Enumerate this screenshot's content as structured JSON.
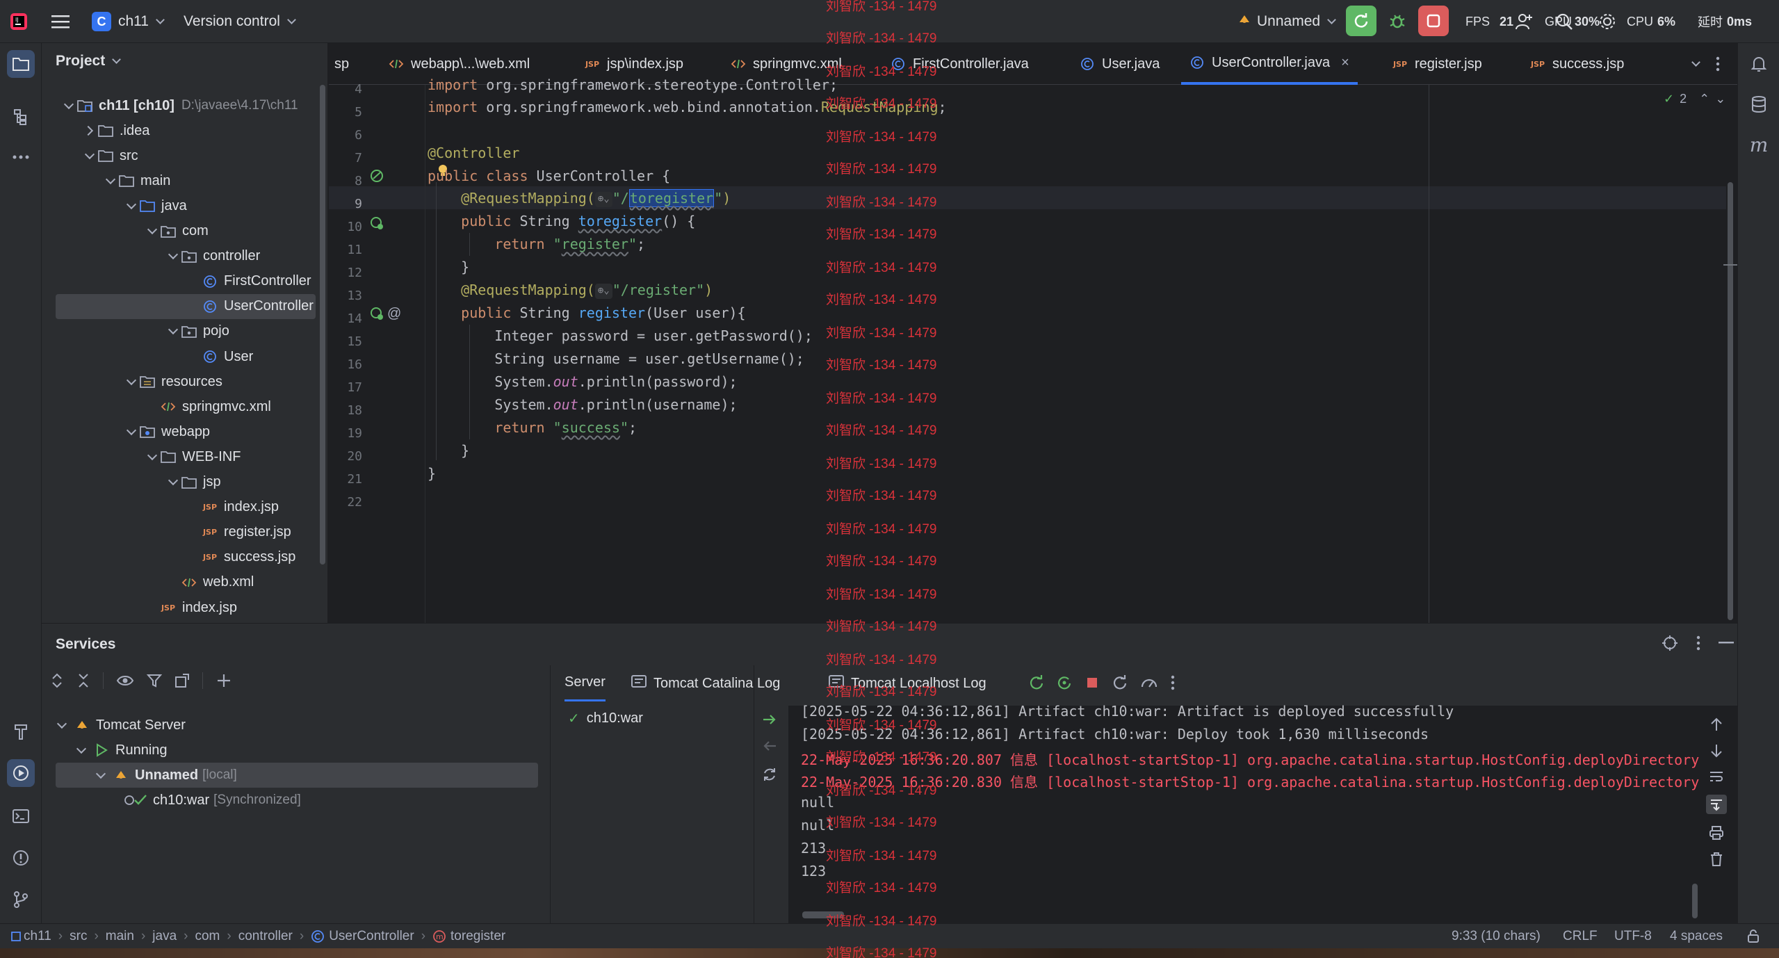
{
  "titlebar": {
    "project_badge": "C",
    "project_name": "ch11",
    "vcs_label": "Version control",
    "run_config": "Unnamed",
    "fps_label": "FPS",
    "fps_value": "21",
    "gpu_label": "GPU",
    "gpu_value": "30%",
    "cpu_label": "CPU",
    "cpu_value": "6%",
    "delay_label": "延时",
    "delay_value": "0ms"
  },
  "project": {
    "header": "Project",
    "tree": [
      {
        "label": "ch11 [ch10]",
        "extra": "D:\\javaee\\4.17\\ch11",
        "level": 0,
        "arrow": "down",
        "icon": "module",
        "bold": true
      },
      {
        "label": ".idea",
        "level": 1,
        "arrow": "right",
        "icon": "folder"
      },
      {
        "label": "src",
        "level": 1,
        "arrow": "down",
        "icon": "folder"
      },
      {
        "label": "main",
        "level": 2,
        "arrow": "down",
        "icon": "folder"
      },
      {
        "label": "java",
        "level": 3,
        "arrow": "down",
        "icon": "src-folder"
      },
      {
        "label": "com",
        "level": 4,
        "arrow": "down",
        "icon": "package"
      },
      {
        "label": "controller",
        "level": 5,
        "arrow": "down",
        "icon": "package"
      },
      {
        "label": "FirstController",
        "level": 6,
        "arrow": "none",
        "icon": "class"
      },
      {
        "label": "UserController",
        "level": 6,
        "arrow": "none",
        "icon": "class",
        "selected": true
      },
      {
        "label": "pojo",
        "level": 5,
        "arrow": "down",
        "icon": "package"
      },
      {
        "label": "User",
        "level": 6,
        "arrow": "none",
        "icon": "class"
      },
      {
        "label": "resources",
        "level": 3,
        "arrow": "down",
        "icon": "res-folder"
      },
      {
        "label": "springmvc.xml",
        "level": 4,
        "arrow": "none",
        "icon": "xml"
      },
      {
        "label": "webapp",
        "level": 3,
        "arrow": "down",
        "icon": "web-folder"
      },
      {
        "label": "WEB-INF",
        "level": 4,
        "arrow": "down",
        "icon": "folder"
      },
      {
        "label": "jsp",
        "level": 5,
        "arrow": "down",
        "icon": "folder"
      },
      {
        "label": "index.jsp",
        "level": 6,
        "arrow": "none",
        "icon": "jsp"
      },
      {
        "label": "register.jsp",
        "level": 6,
        "arrow": "none",
        "icon": "jsp"
      },
      {
        "label": "success.jsp",
        "level": 6,
        "arrow": "none",
        "icon": "jsp"
      },
      {
        "label": "web.xml",
        "level": 5,
        "arrow": "none",
        "icon": "xml"
      },
      {
        "label": "index.jsp",
        "level": 4,
        "arrow": "none",
        "icon": "jsp"
      }
    ]
  },
  "editor": {
    "tabs": [
      {
        "label": "sp",
        "icon": "none"
      },
      {
        "label": "webapp\\...\\web.xml",
        "icon": "xml"
      },
      {
        "label": "jsp\\index.jsp",
        "icon": "jsp"
      },
      {
        "label": "springmvc.xml",
        "icon": "xml"
      },
      {
        "label": "FirstController.java",
        "icon": "class"
      },
      {
        "label": "User.java",
        "icon": "class"
      },
      {
        "label": "UserController.java",
        "icon": "class",
        "active": true
      },
      {
        "label": "register.jsp",
        "icon": "jsp"
      },
      {
        "label": "success.jsp",
        "icon": "jsp"
      }
    ],
    "inspection_count": "2",
    "line_numbers": [
      "4",
      "5",
      "6",
      "7",
      "8",
      "9",
      "10",
      "11",
      "12",
      "13",
      "14",
      "15",
      "16",
      "17",
      "18",
      "19",
      "20",
      "21",
      "22"
    ],
    "code": {
      "l4_a": "import ",
      "l4_b": "org.springframework.stereotype.Controller;",
      "l5_a": "import ",
      "l5_b": "org.springframework.web.bind.annotation.",
      "l5_c": "RequestMapping",
      "l5_d": ";",
      "l7": "@Controller",
      "l8_a": "public class ",
      "l8_b": "UserController {",
      "l9_a": "@RequestMapping(",
      "l9_b": "\"/",
      "l9_c": "toregister",
      "l9_d": "\"",
      "l9_e": ")",
      "l10_a": "public ",
      "l10_b": "String ",
      "l10_c": "toregister",
      "l10_d": "() {",
      "l11_a": "return ",
      "l11_b": "\"",
      "l11_c": "register",
      "l11_d": "\"",
      "l11_e": ";",
      "l12": "}",
      "l13_a": "@RequestMapping(",
      "l13_b": "\"/register\"",
      "l13_c": ")",
      "l14_a": "public ",
      "l14_b": "String ",
      "l14_c": "register",
      "l14_d": "(User user){",
      "l15": "Integer password = user.getPassword();",
      "l16": "String username = user.getUsername();",
      "l17_a": "System.",
      "l17_b": "out",
      "l17_c": ".println(password);",
      "l18_a": "System.",
      "l18_b": "out",
      "l18_c": ".println(username);",
      "l19_a": "return ",
      "l19_b": "\"",
      "l19_c": "success",
      "l19_d": "\"",
      "l19_e": ";",
      "l20": "}",
      "l21": "}"
    }
  },
  "watermark": "刘智欣 -134 - 1479",
  "services": {
    "header": "Services",
    "tree": [
      {
        "label": "Tomcat Server",
        "arrow": "down",
        "icon": "tomcat"
      },
      {
        "label": "Running",
        "arrow": "down",
        "icon": "run"
      },
      {
        "label": "Unnamed",
        "extra": "[local]",
        "arrow": "down",
        "icon": "tomcat",
        "selected": true,
        "bold": true
      },
      {
        "label": "ch10:war",
        "extra": "[Synchronized]",
        "arrow": "none",
        "icon": "artifact"
      }
    ],
    "tabs": [
      "Server",
      "Tomcat Catalina Log",
      "Tomcat Localhost Log"
    ],
    "deployment": "ch10:war",
    "console": [
      {
        "text": "[2025-05-22 04:36:12,861] Artifact ch10:war: Artifact is deployed successfully",
        "err": false
      },
      {
        "text": "[2025-05-22 04:36:12,861] Artifact ch10:war: Deploy took 1,630 milliseconds",
        "err": false
      },
      {
        "text": "22-May-2025 16:36:20.807 信息 [localhost-startStop-1] org.apache.catalina.startup.HostConfig.deployDirectory",
        "err": true
      },
      {
        "text": "22-May-2025 16:36:20.830 信息 [localhost-startStop-1] org.apache.catalina.startup.HostConfig.deployDirectory",
        "err": true
      },
      {
        "text": "null",
        "err": false
      },
      {
        "text": "null",
        "err": false
      },
      {
        "text": "213",
        "err": false
      },
      {
        "text": "123",
        "err": false
      }
    ]
  },
  "statusbar": {
    "crumbs": [
      "ch11",
      "src",
      "main",
      "java",
      "com",
      "controller",
      "UserController",
      "toregister"
    ],
    "position": "9:33 (10 chars)",
    "line_sep": "CRLF",
    "encoding": "UTF-8",
    "indent": "4 spaces"
  },
  "colors": {
    "accent": "#3574f0",
    "bg_editor": "#1e1f22",
    "bg_panel": "#2b2d30",
    "watermark": "#d9323a",
    "run_green": "#5fb865",
    "stop_red": "#db5c5c"
  }
}
